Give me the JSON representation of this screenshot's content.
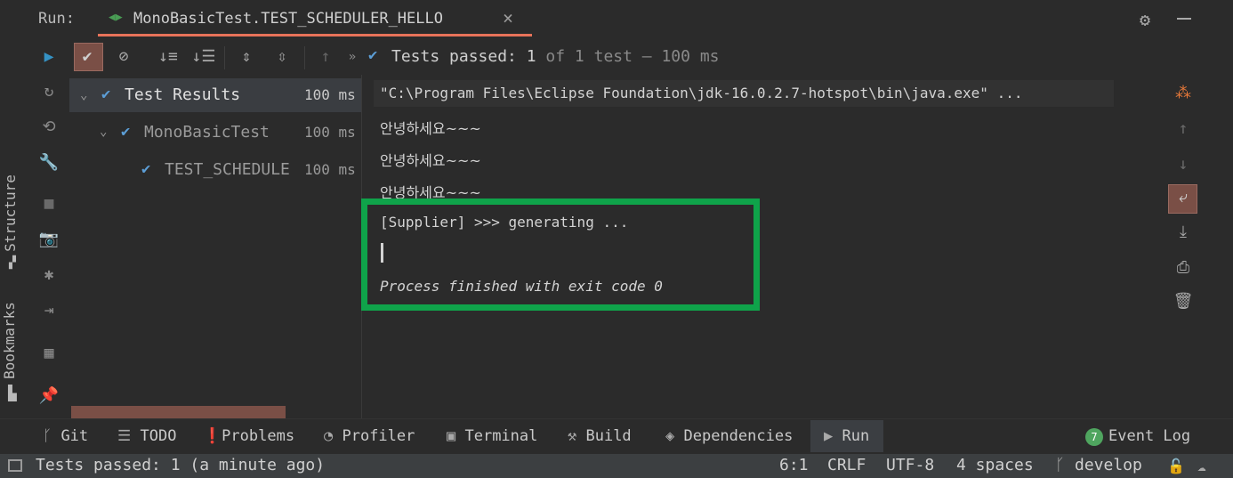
{
  "run_header": {
    "label": "Run:",
    "tab_title": "MonoBasicTest.TEST_SCHEDULER_HELLO",
    "tab_close": "×",
    "settings_icon": "gear-icon",
    "minimize_icon": "minimize-icon"
  },
  "toolbar": {
    "icons": [
      "rerun-icon",
      "show-passed-icon",
      "show-ignored-icon",
      "sort-alphabetically-icon",
      "sort-by-duration-icon",
      "expand-all-icon",
      "collapse-all-icon",
      "previous-failed-icon",
      "more-icon"
    ],
    "status_prefix": "Tests passed:",
    "status_count": "1",
    "status_of": "of 1 test – 100 ms"
  },
  "tree": {
    "root": {
      "label": "Test Results",
      "time": "100 ms"
    },
    "class": {
      "label": "MonoBasicTest",
      "time": "100 ms"
    },
    "method": {
      "label": "TEST_SCHEDULE",
      "time": "100 ms"
    }
  },
  "console": {
    "lines": [
      "\"C:\\Program Files\\Eclipse Foundation\\jdk-16.0.2.7-hotspot\\bin\\java.exe\" ...",
      "안녕하세요~~~",
      "안녕하세요~~~",
      "안녕하세요~~~",
      "[Supplier] >>> generating ...",
      "Process finished with exit code 0"
    ]
  },
  "left_strip": {
    "structure": "Structure",
    "bookmarks": "Bookmarks"
  },
  "bottom_tabs": [
    "Git",
    "TODO",
    "Problems",
    "Profiler",
    "Terminal",
    "Build",
    "Dependencies",
    "Run"
  ],
  "event_log": {
    "badge": "7",
    "label": "Event Log"
  },
  "status_bar": {
    "message": "Tests passed: 1 (a minute ago)",
    "position": "6:1",
    "line_sep": "CRLF",
    "encoding": "UTF-8",
    "indent": "4 spaces",
    "branch": "develop"
  },
  "colors": {
    "accent_tab": "#e8735a",
    "check_blue": "#5c9ed6",
    "highlight_green": "#0fa34a",
    "toggle_bg": "#7a4f46"
  }
}
